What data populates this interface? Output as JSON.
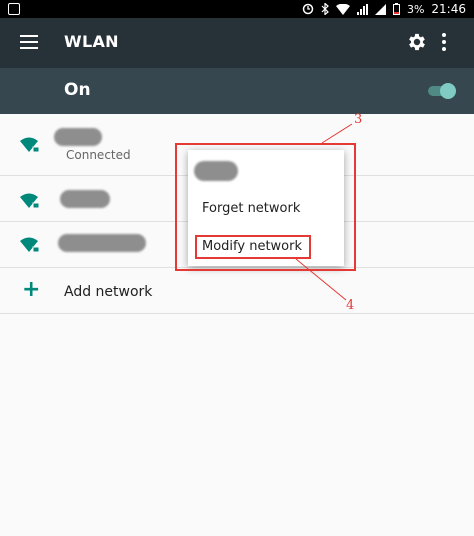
{
  "status_bar": {
    "battery_percent": "3%",
    "time": "21:46"
  },
  "toolbar": {
    "title": "WLAN"
  },
  "wlan_switch": {
    "label": "On",
    "enabled": true
  },
  "networks": [
    {
      "name": "",
      "status": "Connected"
    },
    {
      "name": "",
      "status": ""
    },
    {
      "name": "",
      "status": ""
    }
  ],
  "add_network": {
    "label": "Add network"
  },
  "context_menu": {
    "title": "",
    "items": [
      {
        "label": "Forget network"
      },
      {
        "label": "Modify network"
      }
    ]
  },
  "annotations": [
    {
      "label": "3"
    },
    {
      "label": "4"
    }
  ],
  "colors": {
    "toolbar": "#263238",
    "switch_bar": "#37474f",
    "accent": "#00897b",
    "annotation": "#e53935"
  }
}
